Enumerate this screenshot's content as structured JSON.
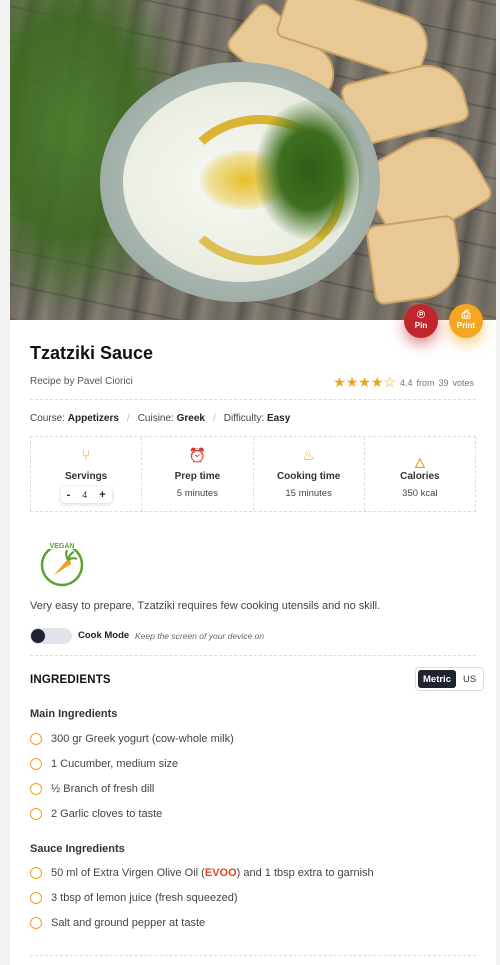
{
  "recipe": {
    "title": "Tzatziki Sauce",
    "byline": "Recipe by Pavel Ciorici",
    "rating": {
      "stars": 4,
      "of": 5,
      "score": "4.4",
      "from": "from",
      "votes": "39",
      "votes_label": "votes"
    }
  },
  "actions": {
    "pin_label": "Pin",
    "print_label": "Print"
  },
  "meta": {
    "course_label": "Course:",
    "course": "Appetizers",
    "cuisine_label": "Cuisine:",
    "cuisine": "Greek",
    "difficulty_label": "Difficulty:",
    "difficulty": "Easy",
    "separator": "/"
  },
  "stats": {
    "servings_label": "Servings",
    "servings_value": "4",
    "prep_label": "Prep time",
    "prep_value": "5 minutes",
    "cooking_label": "Cooking time",
    "cooking_value": "15 minutes",
    "calories_label": "Calories",
    "calories_value": "350 kcal"
  },
  "badge": {
    "text": "VEGAN"
  },
  "intro": "Very easy to prepare, Tzatziki requires few cooking utensils and no skill.",
  "cook_mode": {
    "label": "Cook Mode",
    "hint": "Keep the screen of your device on",
    "enabled": false
  },
  "ingredients": {
    "title": "INGREDIENTS",
    "units": [
      "Metric",
      "US"
    ],
    "active_unit": "Metric",
    "groups": [
      {
        "name": "Main Ingredients",
        "items": [
          "300 gr Greek yogurt (cow-whole milk)",
          "1 Cucumber, medium size",
          "½ Branch of fresh dill",
          "2 Garlic cloves to taste"
        ]
      },
      {
        "name": "Sauce Ingredients",
        "items": [
          "50 ml of Extra Virgen Olive Oil (",
          "EVOO",
          ") and 1 tbsp extra to garnish",
          "3 tbsp of lemon juice (fresh squeezed)",
          "Salt and ground pepper at taste"
        ]
      }
    ]
  },
  "colors": {
    "accent": "#f0a020",
    "pin": "#c0262c",
    "print": "#f5a623",
    "dark": "#1f2430",
    "highlight": "#e0451f"
  }
}
